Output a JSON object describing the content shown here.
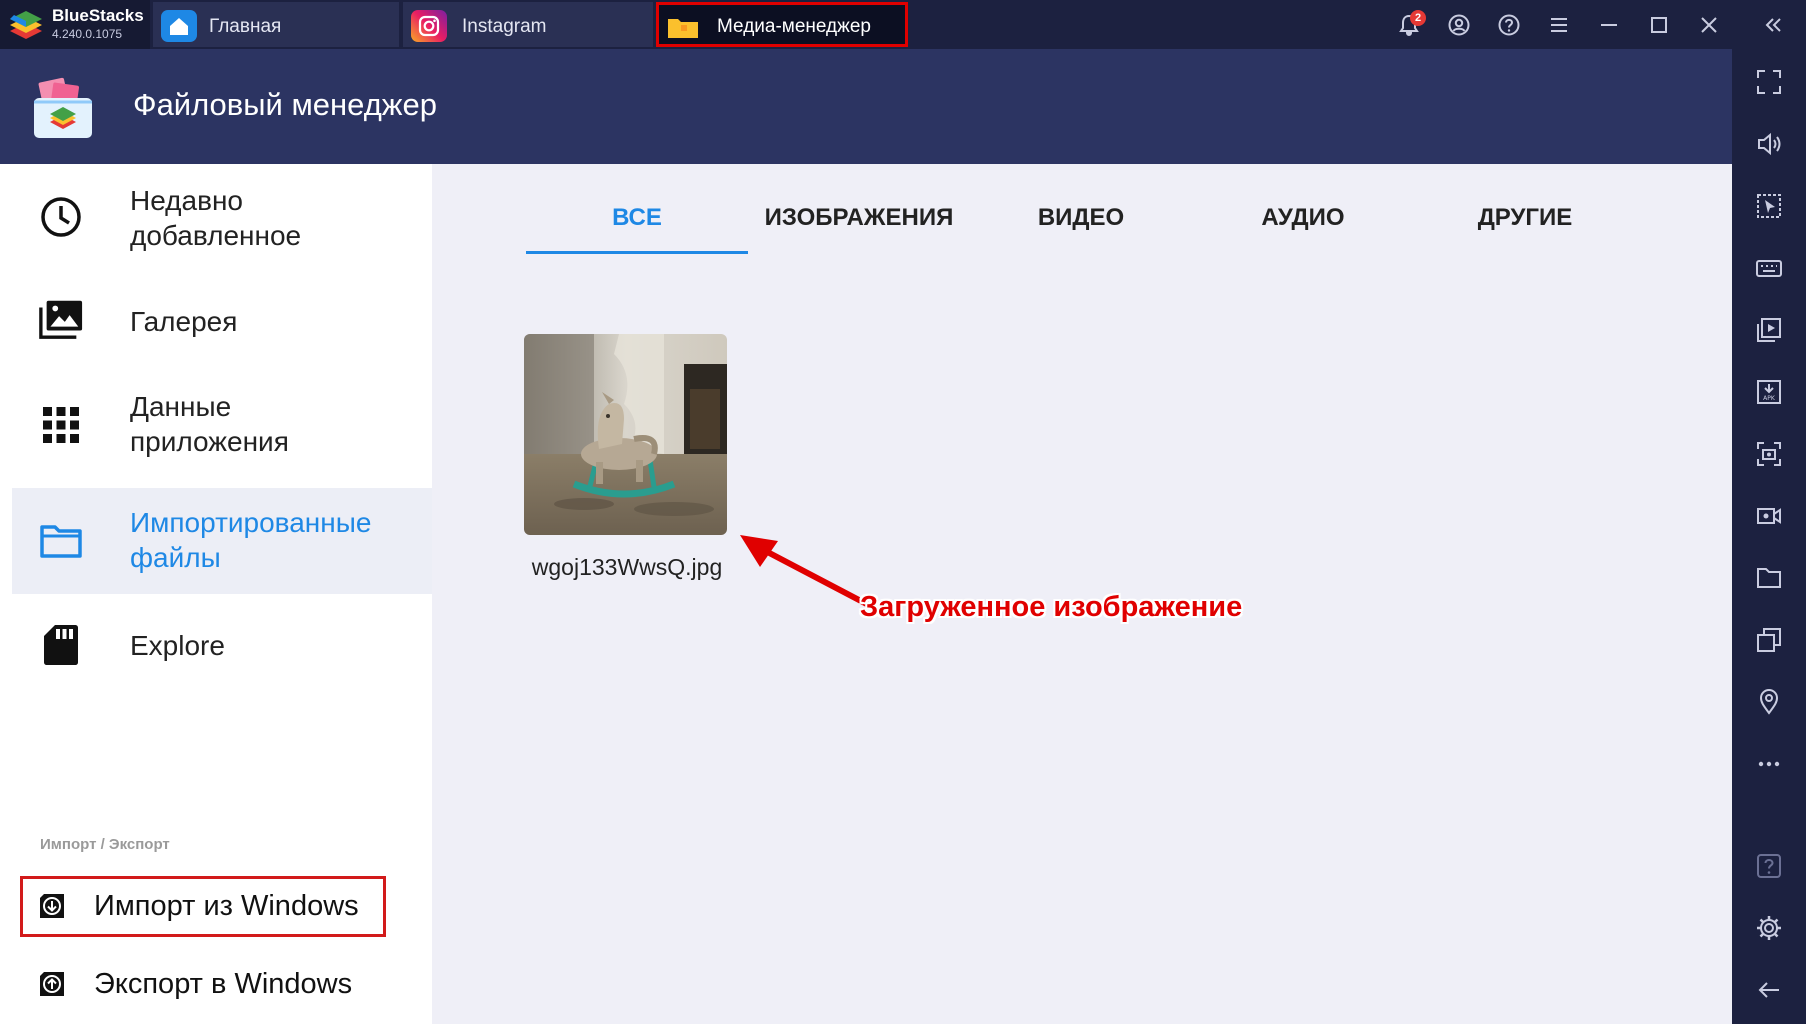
{
  "window": {
    "brand_name": "BlueStacks",
    "brand_version": "4.240.0.1075",
    "tabs": [
      {
        "label": "Главная",
        "icon": "home-icon"
      },
      {
        "label": "Instagram",
        "icon": "instagram-icon"
      },
      {
        "label": "Медиа-менеджер",
        "icon": "folder-icon",
        "active": true
      }
    ],
    "notification_count": "2",
    "controls": [
      "bell-icon",
      "account-icon",
      "help-icon",
      "menu-icon",
      "minimize-icon",
      "maximize-icon",
      "close-icon",
      "collapse-sidebar-icon"
    ]
  },
  "header": {
    "title": "Файловый менеджер"
  },
  "sidebar": {
    "items": [
      {
        "label": "Недавно\nдобавленное",
        "icon": "clock-icon"
      },
      {
        "label": "Галерея",
        "icon": "gallery-icon"
      },
      {
        "label": "Данные\nприложения",
        "icon": "apps-grid-icon"
      },
      {
        "label": "Импортированные\nфайлы",
        "icon": "folder-icon",
        "active": true
      },
      {
        "label": "Explore",
        "icon": "sd-card-icon"
      }
    ],
    "section_label": "Импорт / Экспорт",
    "import_label": "Импорт из Windows",
    "export_label": "Экспорт в Windows"
  },
  "content": {
    "tabs": [
      "ВСЕ",
      "ИЗОБРАЖЕНИЯ",
      "ВИДЕО",
      "АУДИО",
      "ДРУГИЕ"
    ],
    "active_tab": "ВСЕ",
    "files": [
      {
        "name": "wgoj133WwsQ.jpg"
      }
    ],
    "annotation": "Загруженное изображение"
  },
  "rightbar": {
    "icons": [
      "fullscreen-icon",
      "volume-icon",
      "pointer-icon",
      "keyboard-icon",
      "video-cast-icon",
      "apk-install-icon",
      "screenshot-icon",
      "record-icon",
      "folder-icon",
      "multi-instance-icon",
      "location-icon",
      "more-icon",
      "help-icon",
      "settings-icon",
      "back-icon"
    ]
  },
  "colors": {
    "accent": "#1e88e5",
    "highlight_red": "#e00000",
    "titlebar": "#1c2140",
    "header": "#2c3462"
  }
}
